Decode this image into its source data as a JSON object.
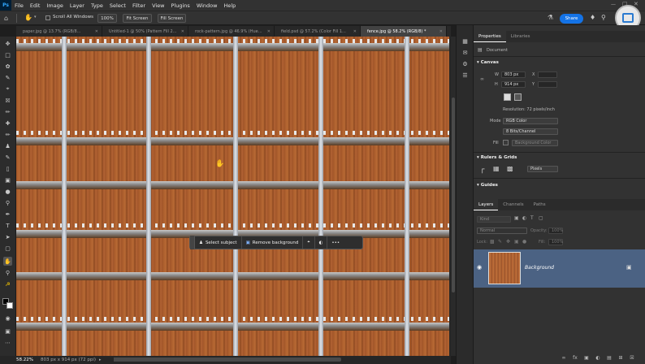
{
  "app": {
    "logo": "Ps",
    "accent": "#31a8ff"
  },
  "menu": [
    "File",
    "Edit",
    "Image",
    "Layer",
    "Type",
    "Select",
    "Filter",
    "View",
    "Plugins",
    "Window",
    "Help"
  ],
  "options": {
    "scroll_all": "Scroll All Windows",
    "zoom_100": "100%",
    "fit_screen": "Fit Screen",
    "fill_screen": "Fill Screen",
    "share": "Share"
  },
  "tabs": [
    {
      "label": "paper.jpg @ 13.7% (RGB/8...",
      "active": false
    },
    {
      "label": "Untitled-1 @ 50% (Pattern Fill 2...",
      "active": false
    },
    {
      "label": "rock-pattern.jpg @ 46.9% (Hue...",
      "active": false
    },
    {
      "label": "field.psd @ 57.2% (Color Fill 1...",
      "active": false
    },
    {
      "label": "fence.jpg @ 58.2% (RGB/8) *",
      "active": true
    }
  ],
  "context_bar": {
    "select_subject": "Select subject",
    "remove_background": "Remove background",
    "more": "•••"
  },
  "status": {
    "zoom": "58.22%",
    "info": "803 px x 914 px (72 ppi)"
  },
  "properties": {
    "tabs": [
      "Properties",
      "Libraries"
    ],
    "doc_label": "Document",
    "canvas_title": "Canvas",
    "w_label": "W",
    "w_value": "803 px",
    "h_label": "H",
    "h_value": "914 px",
    "x_label": "X",
    "y_label": "Y",
    "resolution": "Resolution: 72 pixels/inch",
    "mode_label": "Mode",
    "mode_value": "RGB Color",
    "bits_value": "8 Bits/Channel",
    "fill_label": "Fill",
    "fill_value": "Background Color",
    "rulers_title": "Rulers & Grids",
    "units_value": "Pixels",
    "guides_title": "Guides"
  },
  "layers": {
    "tabs": [
      "Layers",
      "Channels",
      "Paths"
    ],
    "kind": "Kind",
    "blend": "Normal",
    "opacity_label": "Opacity:",
    "opacity_value": "100%",
    "lock_label": "Lock:",
    "fill_label": "Fill:",
    "fill_value": "100%",
    "layer_name": "Background"
  }
}
